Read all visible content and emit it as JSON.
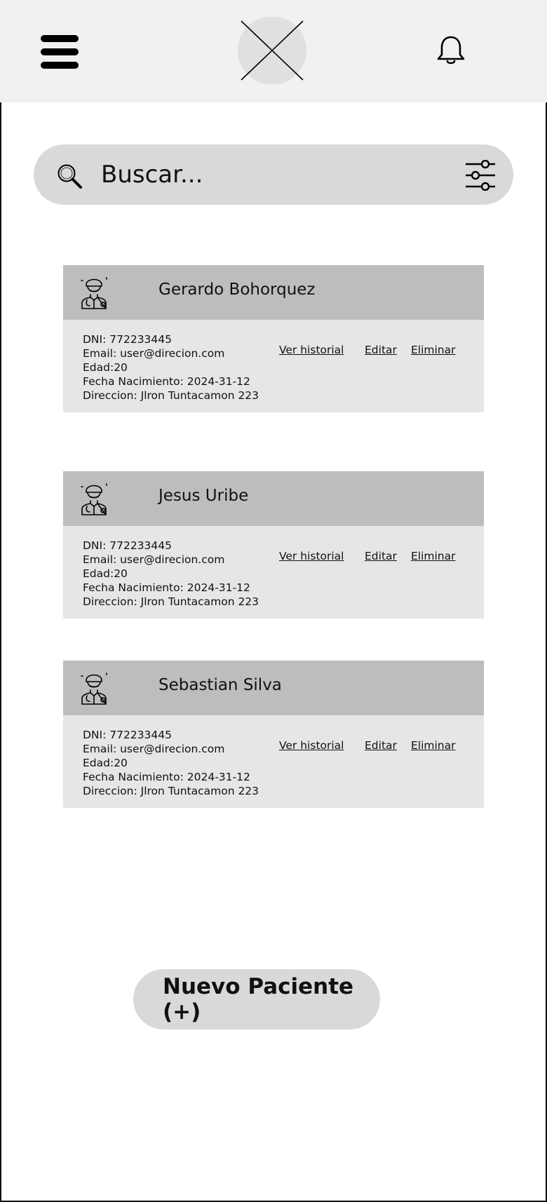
{
  "header": {
    "menu_icon": "hamburger-menu-icon",
    "logo_icon": "logo-placeholder",
    "notification_icon": "bell-icon"
  },
  "search": {
    "placeholder": "Buscar...",
    "search_icon": "search-icon",
    "filter_icon": "filter-sliders-icon"
  },
  "patients": [
    {
      "name": "Gerardo Bohorquez",
      "dni": "DNI: 772233445",
      "email": "Email: user@direcion.com",
      "edad": "Edad:20",
      "fecha": "Fecha Nacimiento: 2024-31-12",
      "direccion": "Direccion: Jlron Tuntacamon 223",
      "ver_historial": "Ver historial",
      "editar": "Editar",
      "eliminar": "Eliminar"
    },
    {
      "name": "Jesus Uribe",
      "dni": "DNI: 772233445",
      "email": "Email: user@direcion.com",
      "edad": "Edad:20",
      "fecha": "Fecha Nacimiento: 2024-31-12",
      "direccion": "Direccion: Jlron Tuntacamon 223",
      "ver_historial": "Ver historial",
      "editar": "Editar",
      "eliminar": "Eliminar"
    },
    {
      "name": "Sebastian Silva",
      "dni": "DNI: 772233445",
      "email": "Email: user@direcion.com",
      "edad": "Edad:20",
      "fecha": "Fecha Nacimiento: 2024-31-12",
      "direccion": "Direccion: Jlron Tuntacamon 223",
      "ver_historial": "Ver historial",
      "editar": "Editar",
      "eliminar": "Eliminar"
    }
  ],
  "new_patient_button": "Nuevo Paciente (+)",
  "colors": {
    "topbar": "#f2f0f0",
    "search_bg": "#d9d9d9",
    "card_header": "#bdbdbd",
    "card_body": "#e6e6e6"
  }
}
